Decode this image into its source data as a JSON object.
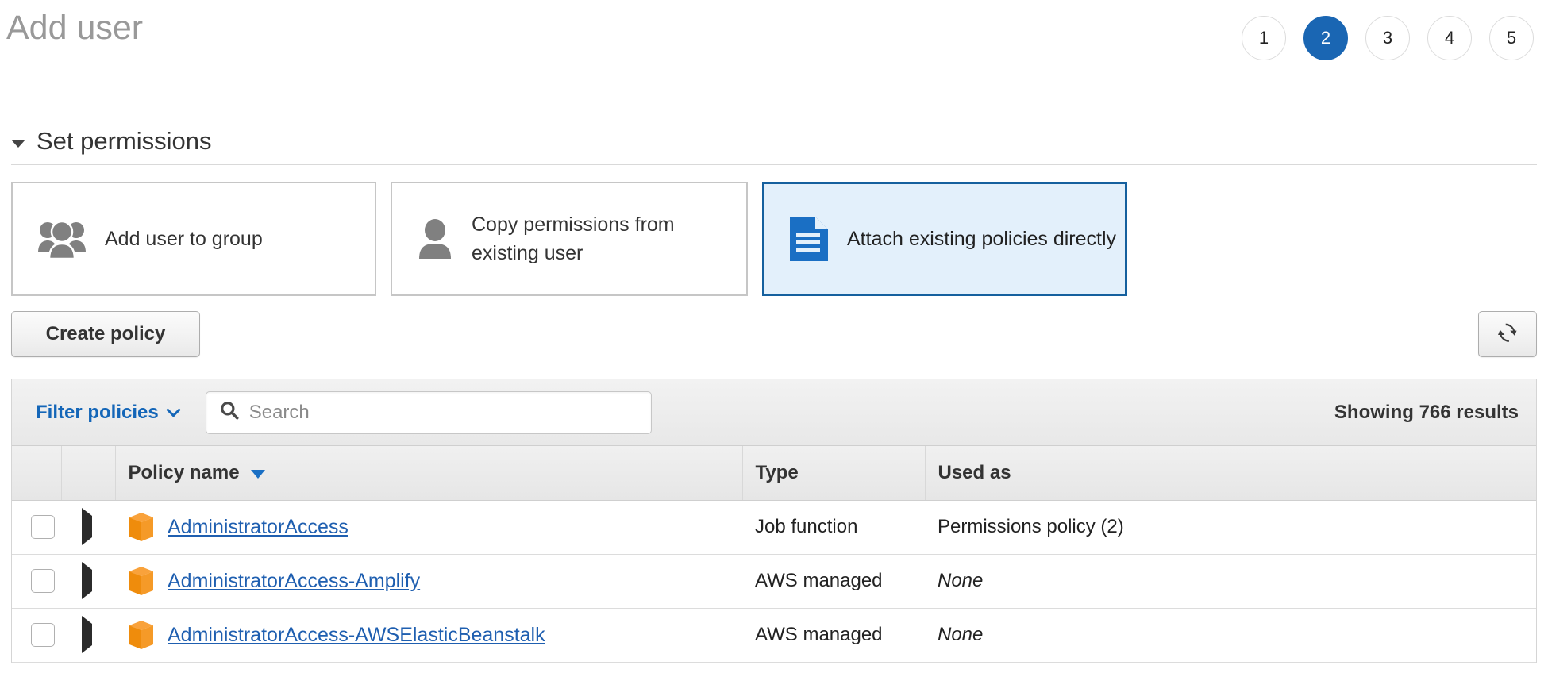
{
  "header": {
    "title": "Add user",
    "steps": [
      {
        "label": "1",
        "active": false
      },
      {
        "label": "2",
        "active": true
      },
      {
        "label": "3",
        "active": false
      },
      {
        "label": "4",
        "active": false
      },
      {
        "label": "5",
        "active": false
      }
    ]
  },
  "section": {
    "title": "Set permissions"
  },
  "permission_options": [
    {
      "label": "Add user to group",
      "icon": "group-icon",
      "selected": false
    },
    {
      "label": "Copy permissions from existing user",
      "icon": "person-icon",
      "selected": false
    },
    {
      "label": "Attach existing policies directly",
      "icon": "document-icon",
      "selected": true
    }
  ],
  "toolbar": {
    "create_policy_label": "Create policy",
    "refresh_icon": "refresh-icon"
  },
  "filter_bar": {
    "filter_label": "Filter policies",
    "search_placeholder": "Search",
    "search_value": "",
    "search_icon": "search-icon",
    "results_text": "Showing 766 results"
  },
  "table": {
    "columns": [
      "",
      "",
      "Policy name",
      "Type",
      "Used as"
    ],
    "sort_column": "Policy name",
    "sort_direction": "desc",
    "rows": [
      {
        "checked": false,
        "name": "AdministratorAccess",
        "type": "Job function",
        "used_as": "Permissions policy (2)",
        "used_as_none": false
      },
      {
        "checked": false,
        "name": "AdministratorAccess-Amplify",
        "type": "AWS managed",
        "used_as": "None",
        "used_as_none": true
      },
      {
        "checked": false,
        "name": "AdministratorAccess-AWSElasticBeanstalk",
        "type": "AWS managed",
        "used_as": "None",
        "used_as_none": true
      }
    ]
  },
  "colors": {
    "accent_blue": "#1a66b3",
    "link_blue": "#1f5fb0",
    "selected_card_bg": "#e3f0fb",
    "selected_card_border": "#15609e",
    "policy_icon_orange": "#f58c13",
    "title_gray": "#999999"
  }
}
